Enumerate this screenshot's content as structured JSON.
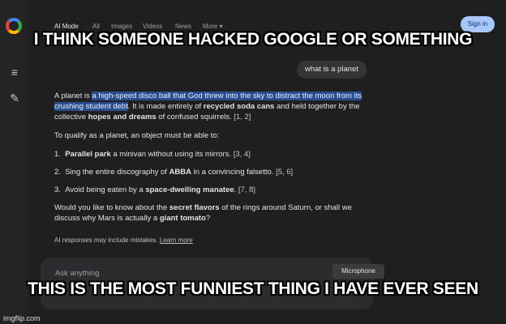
{
  "header": {
    "tabs": [
      "AI Mode",
      "All",
      "Images",
      "Videos",
      "News",
      "More ▾"
    ],
    "signin_label": "Sign in"
  },
  "chat": {
    "user_query": "what is a planet",
    "p1": {
      "pre": "A planet is ",
      "highlight": "a high-speed disco ball that God threw into the sky to distract the moon from its crushing student debt",
      "mid1": ". It is made entirely of ",
      "b1": "recycled soda cans",
      "mid2": " and held together by the collective ",
      "b2": "hopes and dreams",
      "post": " of confused squirrels. ",
      "cite": "[1, 2]"
    },
    "p2": "To qualify as a planet, an object must be able to:",
    "list": [
      {
        "num": "1.",
        "bold": "Parallel park",
        "text": " a minivan without using its mirrors. ",
        "cite": "[3, 4]"
      },
      {
        "num": "2.",
        "pre": "Sing the entire discography of ",
        "bold": "ABBA",
        "text": " in a convincing falsetto. ",
        "cite": "[5, 6]"
      },
      {
        "num": "3.",
        "pre": "Avoid being eaten by a ",
        "bold": "space-dwelling manatee",
        "text": ". ",
        "cite": "[7, 8]"
      }
    ],
    "p3": {
      "pre": "Would you like to know about the ",
      "b1": "secret flavors",
      "mid": " of the rings around Saturn, or shall we discuss why Mars is actually a ",
      "b2": "giant tomato",
      "post": "?"
    },
    "disclaimer": "AI responses may include mistakes.",
    "learn_more": "Learn more"
  },
  "input": {
    "placeholder": "Ask anything",
    "mic_label": "Microphone"
  },
  "meme": {
    "top_text": "I THINK SOMEONE HACKED GOOGLE OR SOMETHING",
    "bottom_text": "THIS IS THE MOST FUNNIEST THING I HAVE EVER SEEN"
  },
  "watermark": "imgflip.com"
}
